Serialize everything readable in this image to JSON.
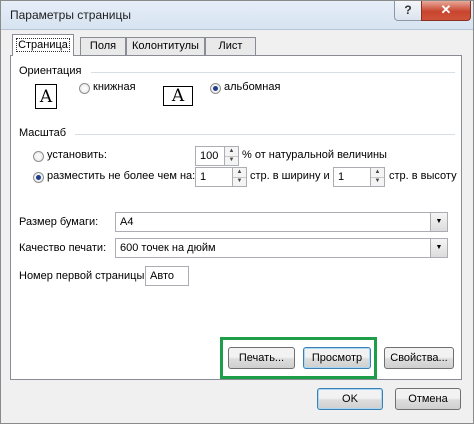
{
  "window": {
    "title": "Параметры страницы",
    "help_label": "?",
    "close_label": "✕"
  },
  "tabs": [
    {
      "label": "Страница",
      "active": true
    },
    {
      "label": "Поля",
      "active": false
    },
    {
      "label": "Колонтитулы",
      "active": false
    },
    {
      "label": "Лист",
      "active": false
    }
  ],
  "orientation": {
    "label": "Ориентация",
    "portrait_label": "книжная",
    "landscape_label": "альбомная",
    "selected": "landscape",
    "icon_letter": "A"
  },
  "scale": {
    "label": "Масштаб",
    "set_label": "установить:",
    "set_value": "100",
    "set_suffix": "% от натуральной величины",
    "fit_label": "разместить не более чем на:",
    "fit_width_value": "1",
    "fit_width_suffix": "стр. в ширину и",
    "fit_height_value": "1",
    "fit_height_suffix": "стр. в высоту",
    "selected": "fit"
  },
  "paper": {
    "label": "Размер бумаги:",
    "value": "A4"
  },
  "quality": {
    "label": "Качество печати:",
    "value": "600 точек на дюйм"
  },
  "first_page": {
    "label": "Номер первой страницы:",
    "value": "Авто"
  },
  "buttons": {
    "print": "Печать...",
    "preview": "Просмотр",
    "properties": "Свойства...",
    "ok": "OK",
    "cancel": "Отмена"
  },
  "colors": {
    "highlight": "#1f9e4a",
    "close": "#c8452e"
  }
}
